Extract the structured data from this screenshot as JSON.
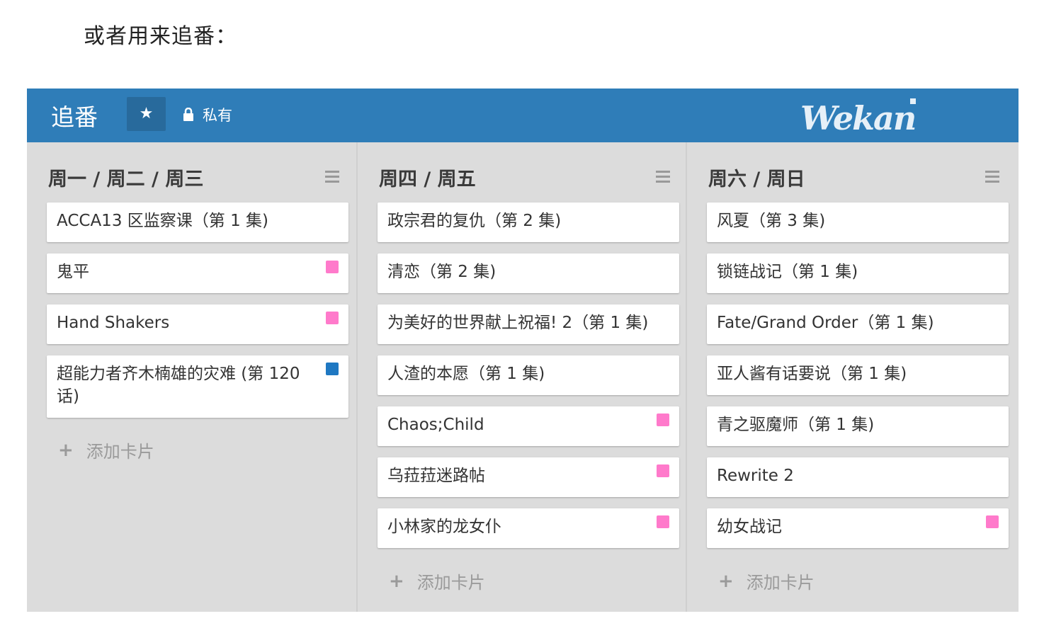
{
  "intro_text": "或者用来追番：",
  "board": {
    "title": "追番",
    "privacy": "私有",
    "logo": "Wekan"
  },
  "colors": {
    "header": "#2f7db8",
    "pink": "#ff7acb",
    "blue": "#1f78c2"
  },
  "add_card_label": "添加卡片",
  "lists": [
    {
      "title": "周一 / 周二 / 周三",
      "cards": [
        {
          "title": "ACCA13 区监察课（第 1 集)",
          "label": ""
        },
        {
          "title": "鬼平",
          "label": "pink"
        },
        {
          "title": "Hand Shakers",
          "label": "pink"
        },
        {
          "title": "超能力者齐木楠雄的灾难 (第 120 话)",
          "label": "blue"
        }
      ]
    },
    {
      "title": "周四 / 周五",
      "cards": [
        {
          "title": "政宗君的复仇（第 2 集)",
          "label": ""
        },
        {
          "title": "清恋（第 2 集)",
          "label": ""
        },
        {
          "title": "为美好的世界献上祝福! 2（第 1 集)",
          "label": ""
        },
        {
          "title": "人渣的本愿（第 1 集)",
          "label": ""
        },
        {
          "title": "Chaos;Child",
          "label": "pink"
        },
        {
          "title": "乌菈菈迷路帖",
          "label": "pink"
        },
        {
          "title": "小林家的龙女仆",
          "label": "pink"
        }
      ]
    },
    {
      "title": "周六 / 周日",
      "cards": [
        {
          "title": "风夏（第 3 集)",
          "label": ""
        },
        {
          "title": "锁链战记（第 1 集)",
          "label": ""
        },
        {
          "title": "Fate/Grand Order（第 1 集)",
          "label": ""
        },
        {
          "title": "亚人酱有话要说（第 1 集)",
          "label": ""
        },
        {
          "title": "青之驱魔师（第 1 集)",
          "label": ""
        },
        {
          "title": "Rewrite 2",
          "label": ""
        },
        {
          "title": "幼女战记",
          "label": "pink"
        }
      ]
    }
  ]
}
